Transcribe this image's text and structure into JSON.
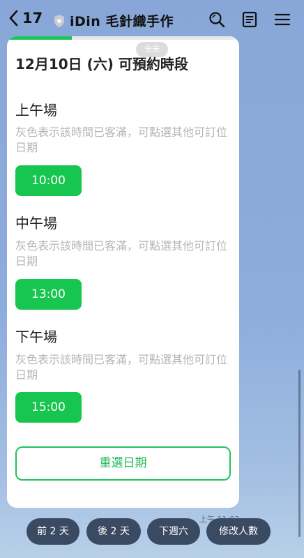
{
  "header": {
    "back_count": "17",
    "title": "iDin 毛針織手作"
  },
  "card": {
    "progress_fraction": 0.28,
    "date_pill": "全天",
    "title": "12月10日 (六) 可預約時段",
    "sections": [
      {
        "title": "上午場",
        "note": "灰色表示該時間已客滿，可點選其他可訂位日期",
        "time": "10:00"
      },
      {
        "title": "中午場",
        "note": "灰色表示該時間已客滿，可點選其他可訂位日期",
        "time": "13:00"
      },
      {
        "title": "下午場",
        "note": "灰色表示該時間已客滿，可點選其他可訂位日期",
        "time": "15:00"
      }
    ],
    "reselect_label": "重選日期"
  },
  "timestamp": "上午 11:03",
  "quick_replies": [
    "前 2 天",
    "後 2 天",
    "下週六",
    "修改人數"
  ],
  "colors": {
    "accent_green": "#17c64f",
    "background_blue": "#8cacdc",
    "quick_reply_bg": "#3b4a63"
  }
}
